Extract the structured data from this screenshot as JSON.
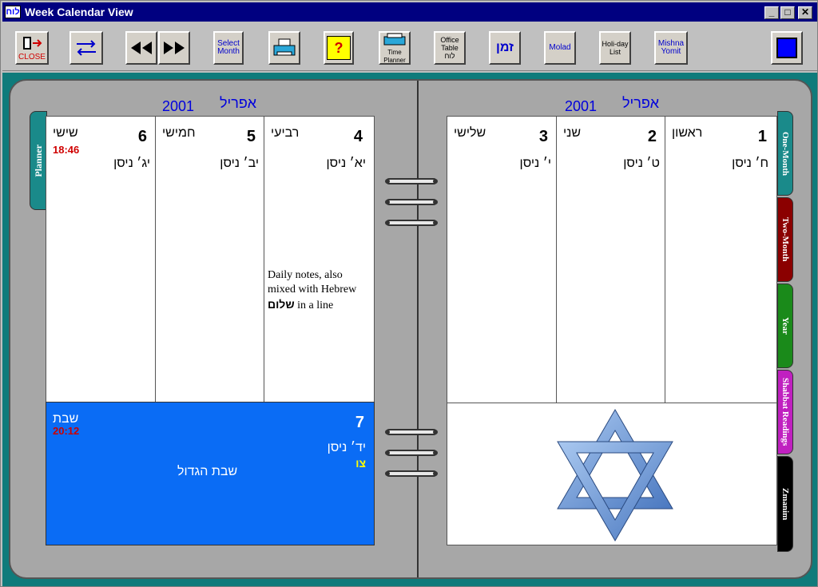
{
  "window": {
    "title": "Week Calendar View",
    "app_icon_text": "לוח",
    "min_glyph": "_",
    "max_glyph": "□",
    "close_glyph": "✕"
  },
  "toolbar": {
    "close_label": "CLOSE",
    "select_month_label": "Select Month",
    "help_label": "?",
    "time_planner_label": "Time Planner",
    "office_table_label": "Office Table לוח",
    "zman_label": "זמן",
    "molad_label": "Molad",
    "holiday_list_label": "Holi-day List",
    "mishna_yomit_label": "Mishna Yomit"
  },
  "left_page": {
    "month": "אפריל",
    "year": "2001",
    "days": [
      {
        "num": "6",
        "name": "שישי",
        "hebrew": "יג׳ ניסן",
        "candle": "18:46"
      },
      {
        "num": "5",
        "name": "חמישי",
        "hebrew": "יב׳ ניסן"
      },
      {
        "num": "4",
        "name": "רביעי",
        "hebrew": "יא׳ ניסן"
      }
    ],
    "notes": {
      "line1": "Daily notes, also",
      "line2": "mixed with Hebrew",
      "heb_word": "שלום",
      "line3": " in a line"
    },
    "shabbat": {
      "num": "7",
      "name": "שבת",
      "hebrew": "יד׳ ניסן",
      "extra": "צו",
      "candle": "20:12",
      "special": "שבת הגדול"
    }
  },
  "right_page": {
    "month": "אפריל",
    "year": "2001",
    "days": [
      {
        "num": "3",
        "name": "שלישי",
        "hebrew": "י׳ ניסן"
      },
      {
        "num": "2",
        "name": "שני",
        "hebrew": "ט׳ ניסן"
      },
      {
        "num": "1",
        "name": "ראשון",
        "hebrew": "ח׳ ניסן"
      }
    ]
  },
  "tabs": {
    "planner": "Planner",
    "one_month": "One-Month",
    "two_month": "Two-Month",
    "year": "Year",
    "shabbat_readings": "Shabbat Readings",
    "zmanim": "Zmanim"
  },
  "colors": {
    "teal_bg": "#0f7b7b",
    "shabbat_blue": "#0a6cf5",
    "candle_red": "#d00000",
    "header_blue": "#0000dd",
    "tab_one_month": "#1a8a8a",
    "tab_two_month": "#8b0000",
    "tab_year": "#1a8a1a",
    "tab_shabbat": "#c020c0",
    "tab_zmanim": "#000000"
  }
}
